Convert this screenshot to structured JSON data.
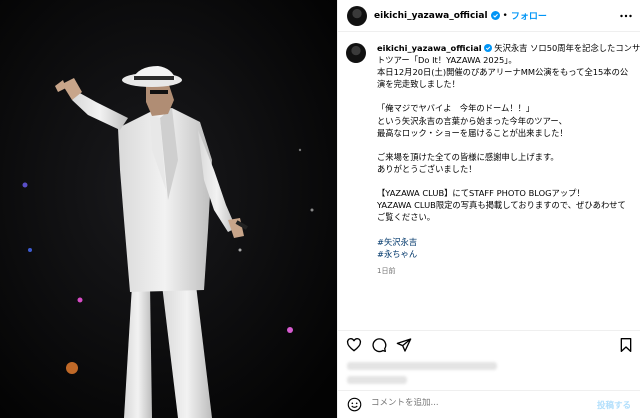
{
  "account": {
    "username": "eikichi_yazawa_official",
    "follow_label": "フォロー",
    "separator": "•"
  },
  "caption": {
    "username": "eikichi_yazawa_official",
    "lines": [
      " 矢沢永吉 ソロ50周年を記念したコンサー",
      "トツアー「Do It！YAZAWA 2025」。",
      "本日12月20日(土)開催のぴあアリーナMM公演をもって全15本の公",
      "演を完走致しました！",
      "",
      "「俺マジでヤバイよ　今年のドーム！！」",
      "という矢沢永吉の言葉から始まった今年のツアー、",
      "最高なロック・ショーを届けることが出来ました！",
      "",
      "ご来場を頂けた全ての皆様に感謝申し上げます。",
      "ありがとうございました！",
      "",
      "【YAZAWA CLUB】にてSTAFF PHOTO BLOGアップ！",
      "YAZAWA CLUB限定の写真も掲載しておりますので、ぜひあわせて",
      "ご覧ください。",
      ""
    ],
    "hashtags": [
      "#矢沢永吉",
      "#永ちゃん"
    ],
    "time": "1日前"
  },
  "icons": {
    "like": "heart-icon",
    "comment": "comment-icon",
    "share": "share-icon",
    "save": "bookmark-icon",
    "more": "more-options-icon",
    "emoji": "emoji-icon",
    "verified": "verified-badge-icon"
  },
  "comment_box": {
    "placeholder": "コメントを追加...",
    "post_label": "投稿する"
  },
  "colors": {
    "accent": "#0095f6",
    "hashtag": "#00376b",
    "muted": "#737373",
    "post_disabled": "#b2dffc"
  }
}
